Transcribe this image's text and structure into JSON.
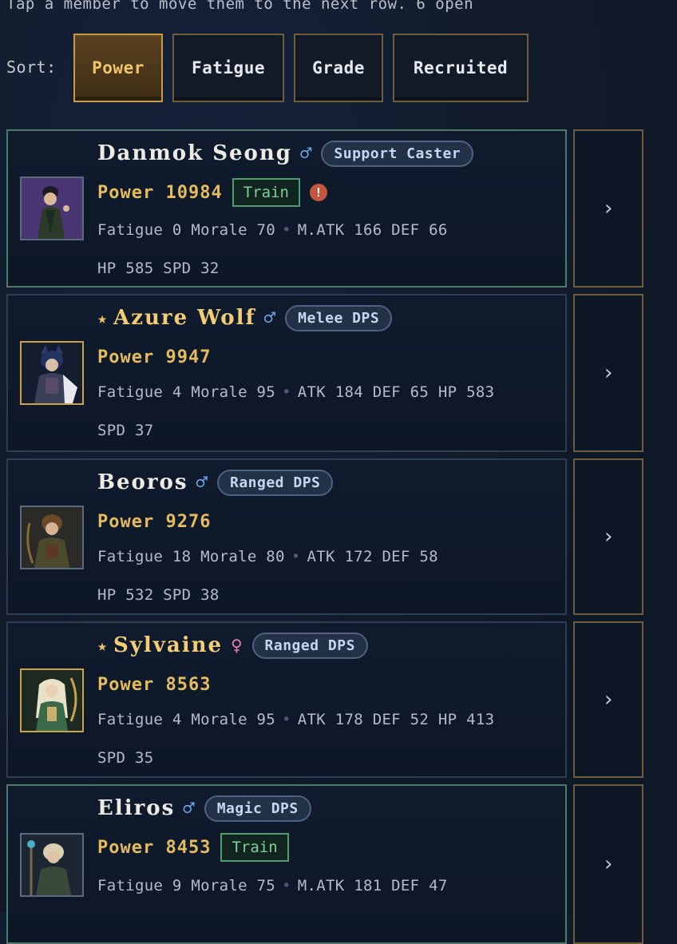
{
  "hint": "Tap a member to move them to the next row. 6 open",
  "sort": {
    "label": "Sort:",
    "options": [
      "Power",
      "Fatigue",
      "Grade",
      "Recruited"
    ],
    "active": "Power"
  },
  "members": [
    {
      "starred": false,
      "name": "Danmok Seong",
      "gender": "♂",
      "role": "Support Caster",
      "power": "Power 10984",
      "train": "Train",
      "alert": "!",
      "stats_line1_a": "Fatigue 0 Morale 70",
      "stats_line1_b": "M.ATK 166 DEF 66",
      "stats_line2": "HP 585 SPD 32",
      "next": "›"
    },
    {
      "starred": true,
      "star": "★",
      "name": "Azure Wolf",
      "gender": "♂",
      "role": "Melee DPS",
      "power": "Power 9947",
      "stats_line1_a": "Fatigue 4 Morale 95",
      "stats_line1_b": "ATK 184 DEF 65 HP 583",
      "stats_line2": "SPD 37",
      "next": "›"
    },
    {
      "starred": false,
      "name": "Beoros",
      "gender": "♂",
      "role": "Ranged DPS",
      "power": "Power 9276",
      "stats_line1_a": "Fatigue 18 Morale 80",
      "stats_line1_b": "ATK 172 DEF 58",
      "stats_line2": "HP 532 SPD 38",
      "next": "›"
    },
    {
      "starred": true,
      "star": "★",
      "name": "Sylvaine",
      "gender": "♀",
      "role": "Ranged DPS",
      "power": "Power 8563",
      "stats_line1_a": "Fatigue 4 Morale 95",
      "stats_line1_b": "ATK 178 DEF 52 HP 413",
      "stats_line2": "SPD 35",
      "next": "›"
    },
    {
      "starred": false,
      "name": "Eliros",
      "gender": "♂",
      "role": "Magic DPS",
      "power": "Power 8453",
      "train": "Train",
      "stats_line1_a": "Fatigue 9 Morale 75",
      "stats_line1_b": "M.ATK 181 DEF 47",
      "next": "›"
    }
  ],
  "colors": {
    "accent_gold": "#e4bb5e",
    "train_green": "#7fcf9c",
    "alert_red": "#c4553f",
    "male_blue": "#6fa6e8",
    "female_pink": "#e87fb4"
  }
}
